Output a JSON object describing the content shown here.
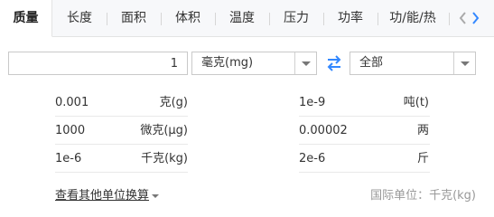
{
  "tabs": [
    "质量",
    "长度",
    "面积",
    "体积",
    "温度",
    "压力",
    "功率",
    "功/能/热"
  ],
  "nav": {
    "prev_icon": "chevron-left-icon",
    "next_icon": "chevron-right-icon"
  },
  "converter": {
    "input_value": "1",
    "from_unit": "毫克(mg)",
    "swap_icon": "swap-arrows-icon",
    "to_unit": "全部"
  },
  "results": {
    "left": [
      {
        "value": "0.001",
        "unit": "克(g)"
      },
      {
        "value": "1000",
        "unit": "微克(μg)"
      },
      {
        "value": "1e-6",
        "unit": "千克(kg)"
      }
    ],
    "right": [
      {
        "value": "1e-9",
        "unit": "吨(t)"
      },
      {
        "value": "0.00002",
        "unit": "两"
      },
      {
        "value": "2e-6",
        "unit": "斤"
      }
    ]
  },
  "footer": {
    "more_link": "查看其他单位换算",
    "international_unit": "国际单位：千克(kg)"
  },
  "colors": {
    "accent": "#3388ff",
    "tab_bg": "#f7f8fa",
    "border": "#c9c9c9"
  }
}
